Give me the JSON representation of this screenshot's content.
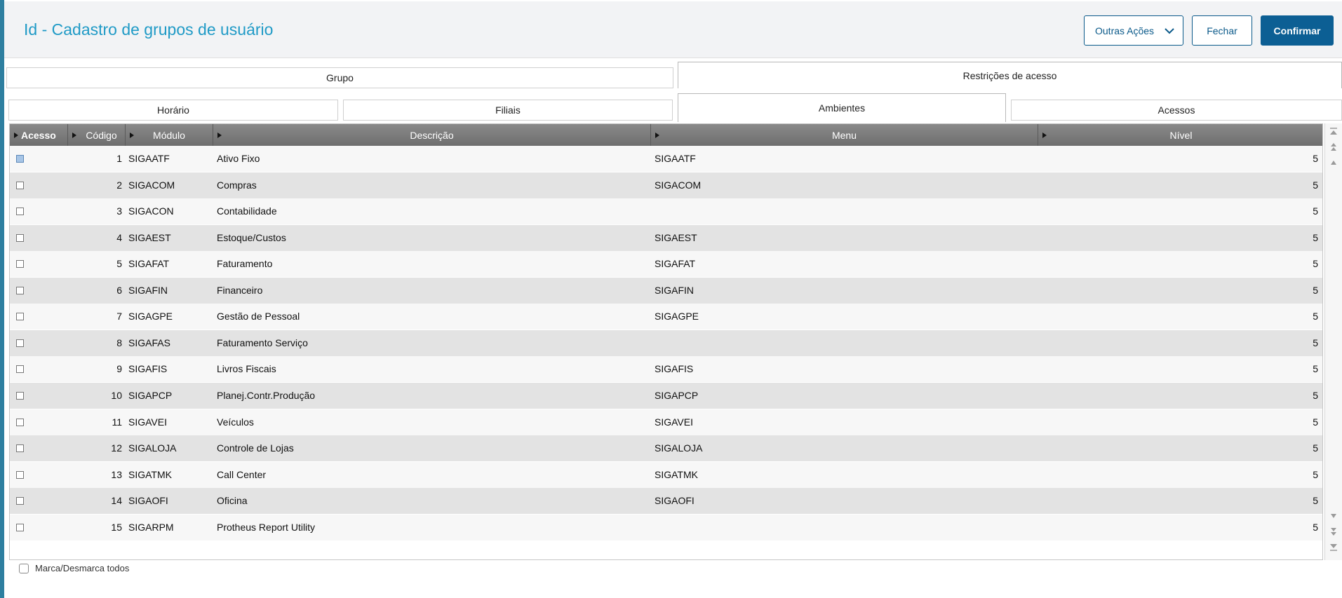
{
  "window": {
    "title": "Id - Cadastro de grupos de usuário"
  },
  "toolbar": {
    "outras_acoes": "Outras Ações",
    "fechar": "Fechar",
    "confirmar": "Confirmar"
  },
  "tabs": {
    "grupo": "Grupo",
    "restricoes": "Restrições de acesso",
    "active": "Restrições de acesso"
  },
  "subtabs": {
    "horario": "Horário",
    "filiais": "Filiais",
    "ambientes": "Ambientes",
    "acessos": "Acessos",
    "active": "Ambientes"
  },
  "grid": {
    "columns": {
      "acesso": "Acesso",
      "codigo": "Código",
      "modulo": "Módulo",
      "descricao": "Descrição",
      "menu": "Menu",
      "nivel": "Nível"
    },
    "rows": [
      {
        "codigo": "1",
        "modulo": "SIGAATF",
        "descricao": "Ativo Fixo",
        "menu": "SIGAATF",
        "nivel": "5",
        "selected": true
      },
      {
        "codigo": "2",
        "modulo": "SIGACOM",
        "descricao": "Compras",
        "menu": "SIGACOM",
        "nivel": "5"
      },
      {
        "codigo": "3",
        "modulo": "SIGACON",
        "descricao": "Contabilidade",
        "menu": "",
        "nivel": "5"
      },
      {
        "codigo": "4",
        "modulo": "SIGAEST",
        "descricao": "Estoque/Custos",
        "menu": "SIGAEST",
        "nivel": "5"
      },
      {
        "codigo": "5",
        "modulo": "SIGAFAT",
        "descricao": "Faturamento",
        "menu": "SIGAFAT",
        "nivel": "5"
      },
      {
        "codigo": "6",
        "modulo": "SIGAFIN",
        "descricao": "Financeiro",
        "menu": "SIGAFIN",
        "nivel": "5"
      },
      {
        "codigo": "7",
        "modulo": "SIGAGPE",
        "descricao": "Gestão de Pessoal",
        "menu": "SIGAGPE",
        "nivel": "5"
      },
      {
        "codigo": "8",
        "modulo": "SIGAFAS",
        "descricao": "Faturamento Serviço",
        "menu": "",
        "nivel": "5"
      },
      {
        "codigo": "9",
        "modulo": "SIGAFIS",
        "descricao": "Livros Fiscais",
        "menu": "SIGAFIS",
        "nivel": "5"
      },
      {
        "codigo": "10",
        "modulo": "SIGAPCP",
        "descricao": "Planej.Contr.Produção",
        "menu": "SIGAPCP",
        "nivel": "5"
      },
      {
        "codigo": "11",
        "modulo": "SIGAVEI",
        "descricao": "Veículos",
        "menu": "SIGAVEI",
        "nivel": "5"
      },
      {
        "codigo": "12",
        "modulo": "SIGALOJA",
        "descricao": "Controle de Lojas",
        "menu": "SIGALOJA",
        "nivel": "5"
      },
      {
        "codigo": "13",
        "modulo": "SIGATMK",
        "descricao": "Call Center",
        "menu": "SIGATMK",
        "nivel": "5"
      },
      {
        "codigo": "14",
        "modulo": "SIGAOFI",
        "descricao": "Oficina",
        "menu": "SIGAOFI",
        "nivel": "5"
      },
      {
        "codigo": "15",
        "modulo": "SIGARPM",
        "descricao": "Protheus Report Utility",
        "menu": "",
        "nivel": "5"
      }
    ]
  },
  "footer": {
    "marca_desmarca": "Marca/Desmarca todos"
  },
  "colors": {
    "accent": "#1f9ac6",
    "primary": "#0c5f94",
    "header_bg": "#f2f3f5",
    "grid_header": "#7c7c7c"
  }
}
